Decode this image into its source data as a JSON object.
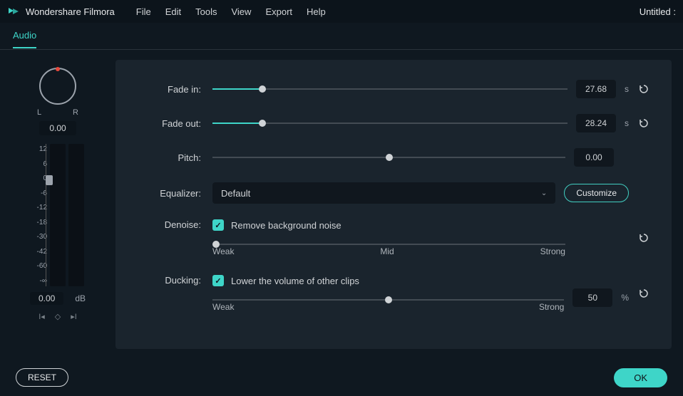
{
  "app": {
    "title": "Wondershare Filmora",
    "doc": "Untitled :"
  },
  "menu": [
    "File",
    "Edit",
    "Tools",
    "View",
    "Export",
    "Help"
  ],
  "tab": "Audio",
  "pan": {
    "l": "L",
    "r": "R",
    "value": "0.00"
  },
  "meter": {
    "scale": [
      "12",
      "6",
      "0",
      "-6",
      "-12",
      "-18",
      "-30",
      "-42",
      "-60",
      "-∞"
    ],
    "value": "0.00",
    "unit": "dB"
  },
  "fade_in": {
    "label": "Fade in:",
    "value": "27.68",
    "unit": "s",
    "pos": 14
  },
  "fade_out": {
    "label": "Fade out:",
    "value": "28.24",
    "unit": "s",
    "pos": 14
  },
  "pitch": {
    "label": "Pitch:",
    "value": "0.00",
    "pos": 50
  },
  "equalizer": {
    "label": "Equalizer:",
    "selected": "Default",
    "customize": "Customize"
  },
  "denoise": {
    "label": "Denoise:",
    "check": "Remove background noise",
    "pos": 1,
    "ticks": [
      "Weak",
      "Mid",
      "Strong"
    ]
  },
  "ducking": {
    "label": "Ducking:",
    "check": "Lower the volume of other clips",
    "pos": 50,
    "value": "50",
    "unit": "%",
    "ticks": [
      "Weak",
      "Strong"
    ]
  },
  "footer": {
    "reset": "RESET",
    "ok": "OK"
  }
}
